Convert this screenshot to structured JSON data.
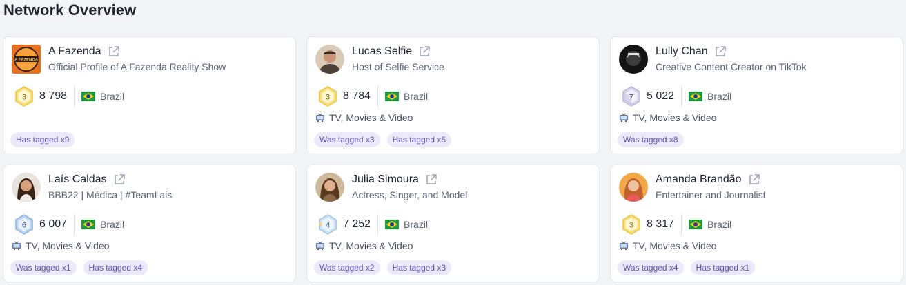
{
  "page": {
    "title": "Network Overview"
  },
  "cards": [
    {
      "name": "A Fazenda",
      "subtitle": "Official Profile of A Fazenda Reality Show",
      "level": "3",
      "followers": "8 798",
      "country": "Brazil",
      "category": "",
      "tags": [
        "Has tagged x9"
      ],
      "avatar_logo_text": "A FAZENDA"
    },
    {
      "name": "Lucas Selfie",
      "subtitle": "Host of Selfie Service",
      "level": "3",
      "followers": "8 784",
      "country": "Brazil",
      "category": "TV, Movies & Video",
      "tags": [
        "Was tagged x3",
        "Has tagged x5"
      ]
    },
    {
      "name": "Lully Chan",
      "subtitle": "Creative Content Creator on TikTok",
      "level": "7",
      "followers": "5 022",
      "country": "Brazil",
      "category": "TV, Movies & Video",
      "tags": [
        "Was tagged x8"
      ]
    },
    {
      "name": "Laís Caldas",
      "subtitle": "BBB22 | Médica | #TeamLais",
      "level": "6",
      "followers": "6 007",
      "country": "Brazil",
      "category": "TV, Movies & Video",
      "tags": [
        "Was tagged x1",
        "Has tagged x4"
      ]
    },
    {
      "name": "Julia Simoura",
      "subtitle": "Actress, Singer, and Model",
      "level": "4",
      "followers": "7 252",
      "country": "Brazil",
      "category": "TV, Movies & Video",
      "tags": [
        "Was tagged x2",
        "Has tagged x3"
      ]
    },
    {
      "name": "Amanda Brandão",
      "subtitle": "Entertainer and Journalist",
      "level": "3",
      "followers": "8 317",
      "country": "Brazil",
      "category": "TV, Movies & Video",
      "tags": [
        "Was tagged x4",
        "Has tagged x1"
      ]
    }
  ],
  "colors": {
    "tag_bg": "#ece9fb",
    "tag_text": "#5a4fb8",
    "gold_badge": "#f3c63a",
    "silver_badge": "#b9b7d6",
    "blue_badge": "#8fb4e6"
  }
}
